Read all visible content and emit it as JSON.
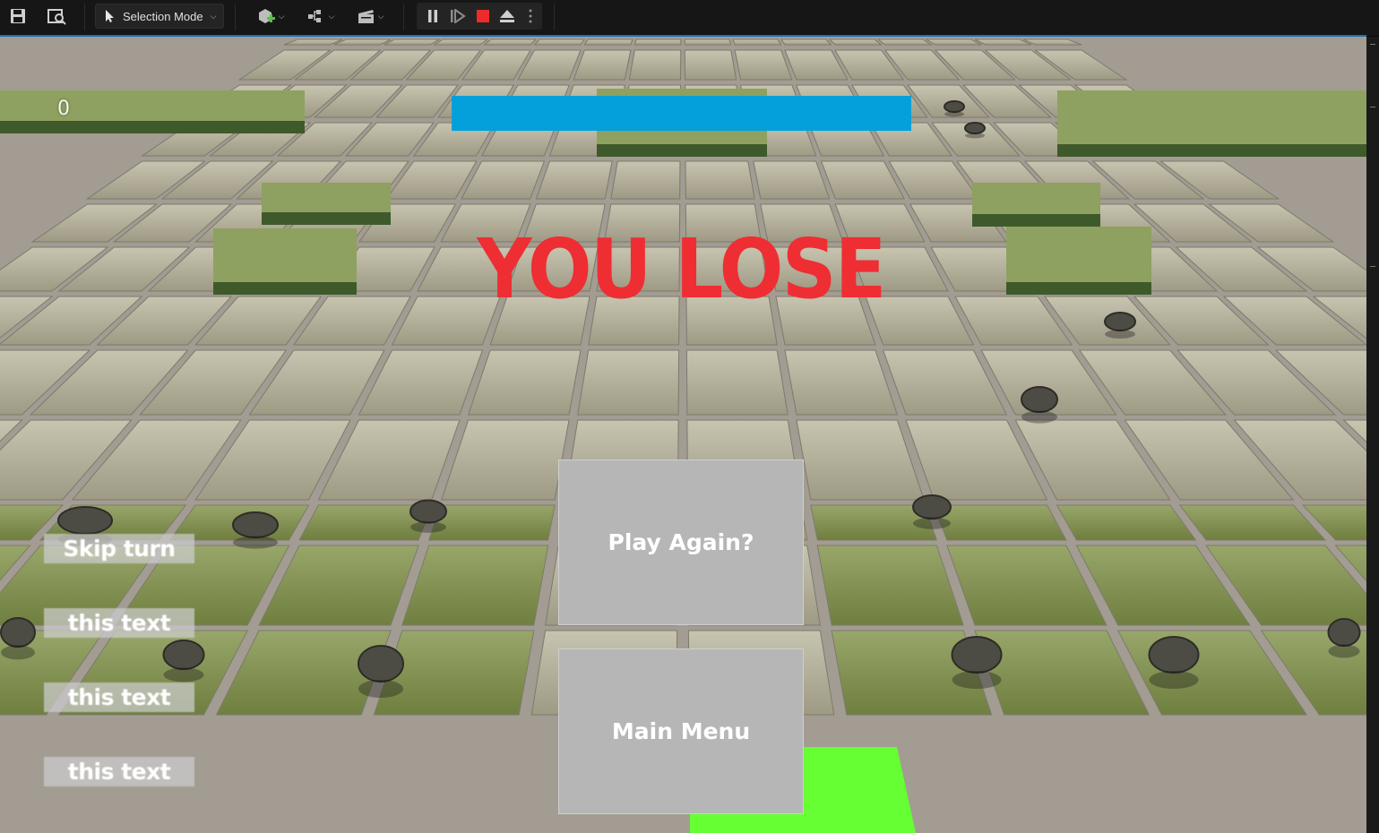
{
  "toolbar": {
    "mode_label": "Selection Mode",
    "icons": [
      "save-icon",
      "browse-icon",
      "add-actor-icon",
      "blueprint-icon",
      "cinematics-icon",
      "pause-icon",
      "step-icon",
      "stop-icon",
      "eject-icon",
      "more-icon"
    ]
  },
  "hud": {
    "score": "0",
    "status_text": "YOU LOSE",
    "colors": {
      "status": "#ee2e33",
      "top_bar": "#03a0dc",
      "highlight_tile": "#66ff33"
    }
  },
  "side_buttons": [
    {
      "label": "Skip turn"
    },
    {
      "label": "this text"
    },
    {
      "label": "this text"
    },
    {
      "label": "this text"
    }
  ],
  "menu": {
    "play_again": "Play Again?",
    "main_menu": "Main Menu"
  }
}
